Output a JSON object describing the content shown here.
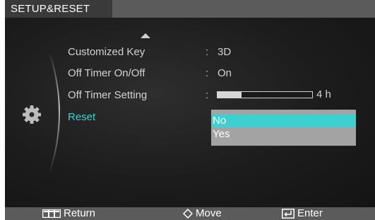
{
  "window": {
    "title": "SETUP&RESET"
  },
  "menu": {
    "items": [
      {
        "label": "Customized Key",
        "colon": ":",
        "value": "3D"
      },
      {
        "label": "Off Timer On/Off",
        "colon": ":",
        "value": "On"
      },
      {
        "label": "Off Timer Setting",
        "colon": ":",
        "value": "4 h",
        "level_fraction": 0.25
      },
      {
        "label": "Reset",
        "active": true
      }
    ]
  },
  "reset_dropdown": {
    "options": [
      "No",
      "Yes"
    ],
    "selected": "No"
  },
  "footer": {
    "return_label": "Return",
    "move_label": "Move",
    "enter_label": "Enter"
  },
  "icons": {
    "category": "gear-icon",
    "scroll_up": "triangle-up-icon",
    "return": "menu-bars-icon",
    "move": "diamond-icon",
    "enter": "enter-icon"
  },
  "colors": {
    "accent": "#3ecfcf",
    "title_bar": "#5b5b5b",
    "dropdown": "#a3a3a3",
    "text": "#d2d2d2"
  }
}
